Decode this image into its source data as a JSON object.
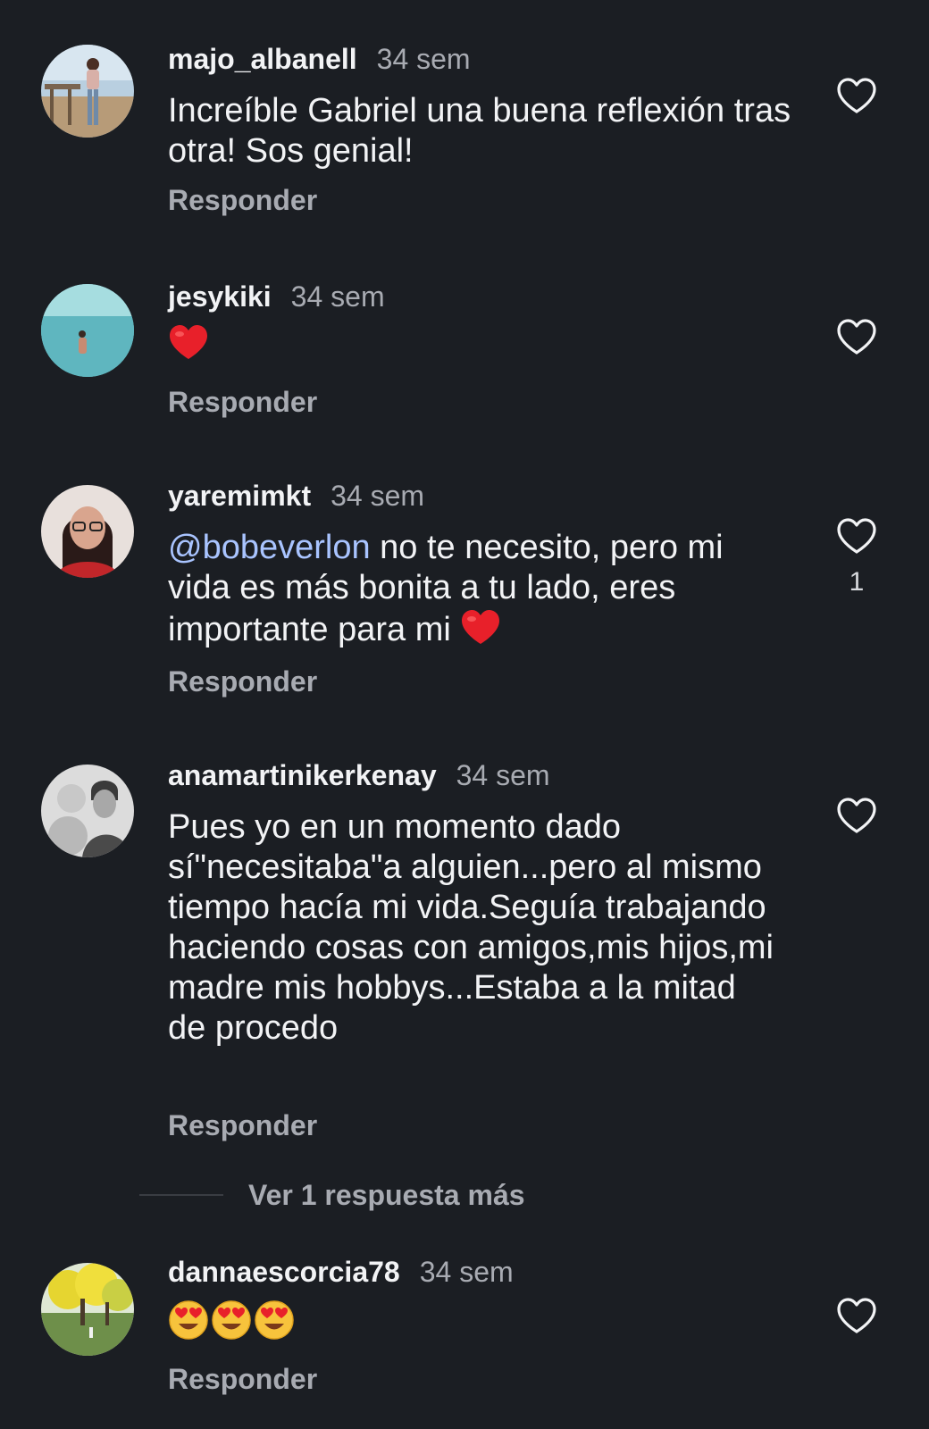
{
  "comments": [
    {
      "username": "majo_albanell",
      "time": "34 sem",
      "text": "Increíble Gabriel una buena reflexión tras otra! Sos genial!",
      "reply_label": "Responder"
    },
    {
      "username": "jesykiki",
      "time": "34 sem",
      "emoji": "red-heart-emoji",
      "reply_label": "Responder"
    },
    {
      "username": "yaremimkt",
      "time": "34 sem",
      "mention": "@bobeverlon",
      "text": " no te necesito, pero mi vida es más bonita a tu lado, eres importante para mi ",
      "emoji": "red-heart-emoji",
      "like_count": "1",
      "reply_label": "Responder"
    },
    {
      "username": "anamartinikerkenay",
      "time": "34 sem",
      "text": "Pues yo en un momento dado sí\"necesitaba\"a alguien...pero al mismo tiempo hacía mi vida.Seguía trabajando  haciendo cosas con amigos,mis hijos,mi madre mis hobbys...Estaba a la mitad de procedo",
      "reply_label": "Responder",
      "more_replies_label": "Ver 1 respuesta más"
    },
    {
      "username": "dannaescorcia78",
      "time": "34 sem",
      "emoji": "heart-eyes-emoji",
      "reply_label": "Responder"
    }
  ],
  "icons": {
    "like": "heart-outline-icon"
  },
  "colors": {
    "background": "#1b1e23",
    "text": "#f2f3f5",
    "muted": "#a8abb2",
    "mention": "#a9c4ff",
    "heart": "#e8202a"
  }
}
